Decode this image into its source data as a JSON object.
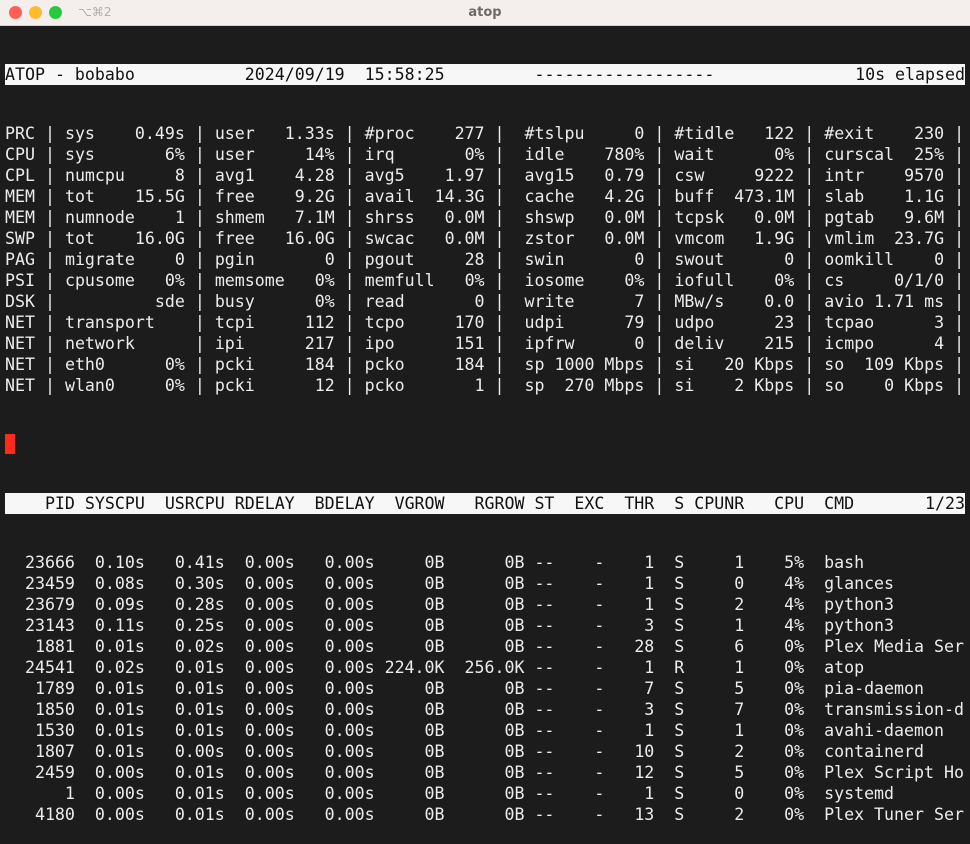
{
  "window": {
    "title": "atop",
    "shortcut": "⌥⌘2"
  },
  "header": {
    "program": "ATOP - bobabo",
    "date": "2024/09/19",
    "time": "15:58:25",
    "dashes": "------------------",
    "elapsed": "10s elapsed"
  },
  "system": [
    {
      "label": "PRC",
      "cells": [
        [
          "sys",
          "0.49s"
        ],
        [
          "user",
          "1.33s"
        ],
        [
          "#proc",
          "277"
        ],
        [
          "#tslpu",
          "0"
        ],
        [
          "#tidle",
          "122"
        ],
        [
          "#exit",
          "230"
        ]
      ]
    },
    {
      "label": "CPU",
      "cells": [
        [
          "sys",
          "6%"
        ],
        [
          "user",
          "14%"
        ],
        [
          "irq",
          "0%"
        ],
        [
          "idle",
          "780%"
        ],
        [
          "wait",
          "0%"
        ],
        [
          "curscal",
          "25%"
        ]
      ]
    },
    {
      "label": "CPL",
      "cells": [
        [
          "numcpu",
          "8"
        ],
        [
          "avg1",
          "4.28"
        ],
        [
          "avg5",
          "1.97"
        ],
        [
          "avg15",
          "0.79"
        ],
        [
          "csw",
          "9222"
        ],
        [
          "intr",
          "9570"
        ]
      ]
    },
    {
      "label": "MEM",
      "cells": [
        [
          "tot",
          "15.5G"
        ],
        [
          "free",
          "9.2G"
        ],
        [
          "avail",
          "14.3G"
        ],
        [
          "cache",
          "4.2G"
        ],
        [
          "buff",
          "473.1M"
        ],
        [
          "slab",
          "1.1G"
        ]
      ]
    },
    {
      "label": "MEM",
      "cells": [
        [
          "numnode",
          "1"
        ],
        [
          "shmem",
          "7.1M"
        ],
        [
          "shrss",
          "0.0M"
        ],
        [
          "shswp",
          "0.0M"
        ],
        [
          "tcpsk",
          "0.0M"
        ],
        [
          "pgtab",
          "9.6M"
        ]
      ]
    },
    {
      "label": "SWP",
      "cells": [
        [
          "tot",
          "16.0G"
        ],
        [
          "free",
          "16.0G"
        ],
        [
          "swcac",
          "0.0M"
        ],
        [
          "zstor",
          "0.0M"
        ],
        [
          "vmcom",
          "1.9G"
        ],
        [
          "vmlim",
          "23.7G"
        ]
      ]
    },
    {
      "label": "PAG",
      "cells": [
        [
          "migrate",
          "0"
        ],
        [
          "pgin",
          "0"
        ],
        [
          "pgout",
          "28"
        ],
        [
          "swin",
          "0"
        ],
        [
          "swout",
          "0"
        ],
        [
          "oomkill",
          "0"
        ]
      ]
    },
    {
      "label": "PSI",
      "cells": [
        [
          "cpusome",
          "0%"
        ],
        [
          "memsome",
          "0%"
        ],
        [
          "memfull",
          "0%"
        ],
        [
          "iosome",
          "0%"
        ],
        [
          "iofull",
          "0%"
        ],
        [
          "cs",
          "0/1/0"
        ]
      ]
    },
    {
      "label": "DSK",
      "cells": [
        [
          "",
          "sde"
        ],
        [
          "busy",
          "0%"
        ],
        [
          "read",
          "0"
        ],
        [
          "write",
          "7"
        ],
        [
          "MBw/s",
          "0.0"
        ],
        [
          "avio",
          "1.71 ms"
        ]
      ]
    },
    {
      "label": "NET",
      "cells": [
        [
          "transport",
          ""
        ],
        [
          "tcpi",
          "112"
        ],
        [
          "tcpo",
          "170"
        ],
        [
          "udpi",
          "79"
        ],
        [
          "udpo",
          "23"
        ],
        [
          "tcpao",
          "3"
        ]
      ]
    },
    {
      "label": "NET",
      "cells": [
        [
          "network",
          ""
        ],
        [
          "ipi",
          "217"
        ],
        [
          "ipo",
          "151"
        ],
        [
          "ipfrw",
          "0"
        ],
        [
          "deliv",
          "215"
        ],
        [
          "icmpo",
          "4"
        ]
      ]
    },
    {
      "label": "NET",
      "cells": [
        [
          "eth0",
          "0%"
        ],
        [
          "pcki",
          "184"
        ],
        [
          "pcko",
          "184"
        ],
        [
          "sp",
          "1000 Mbps"
        ],
        [
          "si",
          "20 Kbps"
        ],
        [
          "so",
          "109 Kbps"
        ]
      ]
    },
    {
      "label": "NET",
      "cells": [
        [
          "wlan0",
          "0%"
        ],
        [
          "pcki",
          "12"
        ],
        [
          "pcko",
          "1"
        ],
        [
          "sp",
          "270 Mbps"
        ],
        [
          "si",
          "2 Kbps"
        ],
        [
          "so",
          "0 Kbps"
        ]
      ]
    }
  ],
  "process_table": {
    "columns": [
      "PID",
      "SYSCPU",
      "USRCPU",
      "RDELAY",
      "BDELAY",
      "VGROW",
      "RGROW",
      "ST",
      "EXC",
      "THR",
      "S",
      "CPUNR",
      "CPU",
      "CMD"
    ],
    "page": "1/23",
    "rows": [
      [
        "23666",
        "0.10s",
        "0.41s",
        "0.00s",
        "0.00s",
        "0B",
        "0B",
        "--",
        "-",
        "1",
        "S",
        "1",
        "5%",
        "bash"
      ],
      [
        "23459",
        "0.08s",
        "0.30s",
        "0.00s",
        "0.00s",
        "0B",
        "0B",
        "--",
        "-",
        "1",
        "S",
        "0",
        "4%",
        "glances"
      ],
      [
        "23679",
        "0.09s",
        "0.28s",
        "0.00s",
        "0.00s",
        "0B",
        "0B",
        "--",
        "-",
        "1",
        "S",
        "2",
        "4%",
        "python3"
      ],
      [
        "23143",
        "0.11s",
        "0.25s",
        "0.00s",
        "0.00s",
        "0B",
        "0B",
        "--",
        "-",
        "3",
        "S",
        "1",
        "4%",
        "python3"
      ],
      [
        "1881",
        "0.01s",
        "0.02s",
        "0.00s",
        "0.00s",
        "0B",
        "0B",
        "--",
        "-",
        "28",
        "S",
        "6",
        "0%",
        "Plex Media Ser"
      ],
      [
        "24541",
        "0.02s",
        "0.01s",
        "0.00s",
        "0.00s",
        "224.0K",
        "256.0K",
        "--",
        "-",
        "1",
        "R",
        "1",
        "0%",
        "atop"
      ],
      [
        "1789",
        "0.01s",
        "0.01s",
        "0.00s",
        "0.00s",
        "0B",
        "0B",
        "--",
        "-",
        "7",
        "S",
        "5",
        "0%",
        "pia-daemon"
      ],
      [
        "1850",
        "0.01s",
        "0.01s",
        "0.00s",
        "0.00s",
        "0B",
        "0B",
        "--",
        "-",
        "3",
        "S",
        "7",
        "0%",
        "transmission-d"
      ],
      [
        "1530",
        "0.01s",
        "0.01s",
        "0.00s",
        "0.00s",
        "0B",
        "0B",
        "--",
        "-",
        "1",
        "S",
        "1",
        "0%",
        "avahi-daemon"
      ],
      [
        "1807",
        "0.01s",
        "0.00s",
        "0.00s",
        "0.00s",
        "0B",
        "0B",
        "--",
        "-",
        "10",
        "S",
        "2",
        "0%",
        "containerd"
      ],
      [
        "2459",
        "0.00s",
        "0.01s",
        "0.00s",
        "0.00s",
        "0B",
        "0B",
        "--",
        "-",
        "12",
        "S",
        "5",
        "0%",
        "Plex Script Ho"
      ],
      [
        "1",
        "0.00s",
        "0.01s",
        "0.00s",
        "0.00s",
        "0B",
        "0B",
        "--",
        "-",
        "1",
        "S",
        "0",
        "0%",
        "systemd"
      ],
      [
        "4180",
        "0.00s",
        "0.01s",
        "0.00s",
        "0.00s",
        "0B",
        "0B",
        "--",
        "-",
        "13",
        "S",
        "2",
        "0%",
        "Plex Tuner Ser"
      ]
    ]
  },
  "colors": {
    "terminal_bg": "#1c1c1c",
    "text": "#ececec",
    "cursor": "#ff2a1a",
    "inverse_bg": "#f7f7f7"
  }
}
